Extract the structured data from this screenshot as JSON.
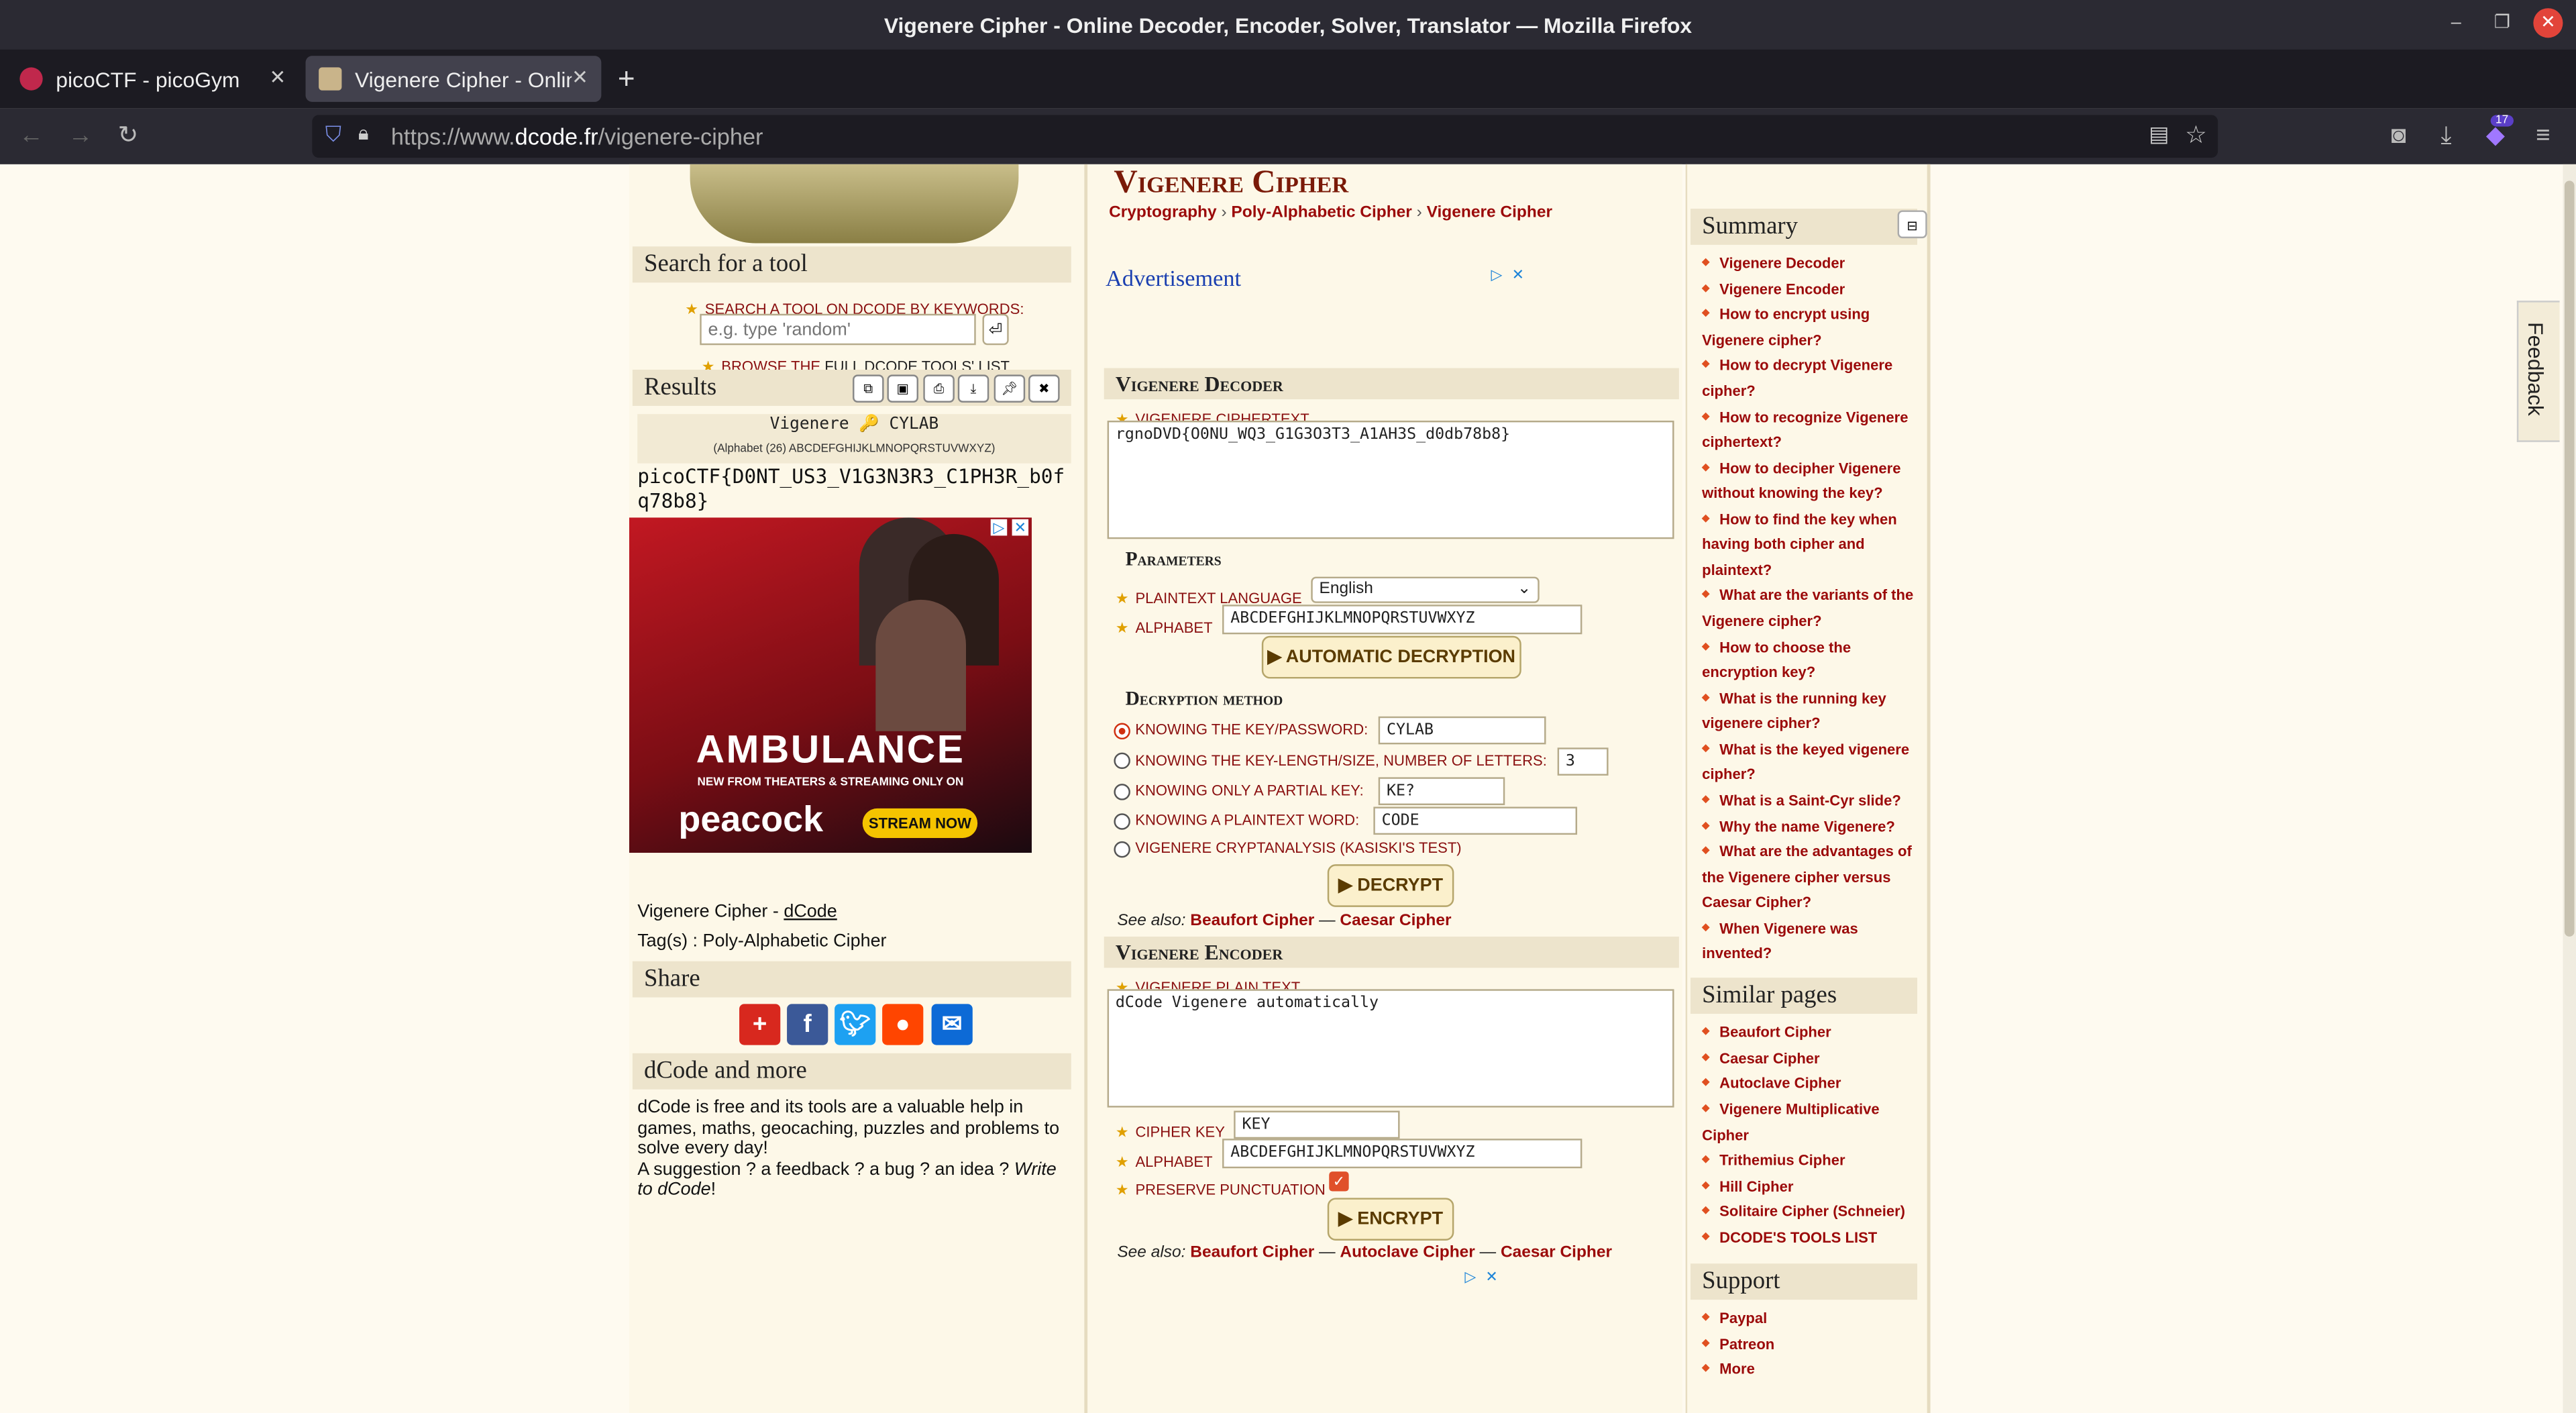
{
  "window": {
    "title": "Vigenere Cipher - Online Decoder, Encoder, Solver, Translator — Mozilla Firefox"
  },
  "tabs": [
    {
      "label": "picoCTF - picoGym"
    },
    {
      "label": "Vigenere Cipher - Online"
    }
  ],
  "urlbar": {
    "prefix": "https://www.",
    "domain": "dcode.fr",
    "path": "/vigenere-cipher"
  },
  "extensions": {
    "badge": "17"
  },
  "left": {
    "search_title": "Search for a tool",
    "search_label": "SEARCH A TOOL ON DCODE BY KEYWORDS:",
    "search_placeholder": "e.g. type 'random'",
    "enter_glyph": "⏎",
    "browse_prefix": "BROWSE THE ",
    "browse_link": "FULL DCODE TOOLS' LIST",
    "results_title": "Results",
    "result_header": "Vigenere 🔑 CYLAB",
    "result_alphabet": "(Alphabet (26) ABCDEFGHIJKLMNOPQRSTUVWXYZ)",
    "result_text": "picoCTF{D0NT_US3_V1G3N3R3_C1PH3R_b0fq78b8}",
    "ad": {
      "title": "AMBULANCE",
      "sub": "NEW FROM THEATERS & STREAMING ONLY ON",
      "brand": "peacock",
      "cta": "STREAM NOW"
    },
    "credit_prefix": "Vigenere Cipher - ",
    "credit_link": "dCode",
    "tags": "Tag(s) : Poly-Alphabetic Cipher",
    "share_title": "Share",
    "more_title": "dCode and more",
    "more_text": "dCode is free and its tools are a valuable help in games, maths, geocaching, puzzles and problems to solve every day!",
    "more_text2": "A suggestion ? a feedback ? a bug ? an idea ? ",
    "more_link": "Write to dCode",
    "more_end": "!"
  },
  "main": {
    "title": "Vigenere Cipher",
    "breadcrumb": [
      "Cryptography",
      "Poly-Alphabetic Cipher",
      "Vigenere Cipher"
    ],
    "advert": "Advertisement",
    "decoder": {
      "title": "Vigenere Decoder",
      "cipher_label": "VIGENERE CIPHERTEXT",
      "cipher_value": "rgnoDVD{O0NU_WQ3_G1G3O3T3_A1AH3S_d0db78b8}",
      "params_title": "Parameters",
      "lang_label": "PLAINTEXT LANGUAGE",
      "lang_value": "English",
      "alpha_label": "ALPHABET",
      "alpha_value": "ABCDEFGHIJKLMNOPQRSTUVWXYZ",
      "auto_button": "▶ AUTOMATIC DECRYPTION",
      "method_title": "Decryption method",
      "m1": "KNOWING THE KEY/PASSWORD:",
      "m1_value": "CYLAB",
      "m2": "KNOWING THE KEY-LENGTH/SIZE, NUMBER OF LETTERS:",
      "m2_value": "3",
      "m3": "KNOWING ONLY A PARTIAL KEY:",
      "m3_value": "KE?",
      "m4": "KNOWING A PLAINTEXT WORD:",
      "m4_value": "CODE",
      "m5": "VIGENERE CRYPTANALYSIS (KASISKI'S TEST)",
      "decrypt_button": "▶ DECRYPT",
      "see_also": "See also:",
      "see_links": [
        "Beaufort Cipher",
        "Caesar Cipher"
      ]
    },
    "encoder": {
      "title": "Vigenere Encoder",
      "plain_label": "VIGENERE PLAIN TEXT",
      "plain_value": "dCode Vigenere automatically",
      "key_label": "CIPHER KEY",
      "key_value": "KEY",
      "alpha_label": "ALPHABET",
      "alpha_value": "ABCDEFGHIJKLMNOPQRSTUVWXYZ",
      "punct_label": "PRESERVE PUNCTUATION",
      "encrypt_button": "▶ ENCRYPT",
      "see_also": "See also:",
      "see_links": [
        "Beaufort Cipher",
        "Autoclave Cipher",
        "Caesar Cipher"
      ]
    },
    "separator": "—"
  },
  "right": {
    "summary_title": "Summary",
    "summary": [
      "Vigenere Decoder",
      "Vigenere Encoder",
      "How to encrypt using Vigenere cipher?",
      "How to decrypt Vigenere cipher?",
      "How to recognize Vigenere ciphertext?",
      "How to decipher Vigenere without knowing the key?",
      "How to find the key when having both cipher and plaintext?",
      "What are the variants of the Vigenere cipher?",
      "How to choose the encryption key?",
      "What is the running key vigenere cipher?",
      "What is the keyed vigenere cipher?",
      "What is a Saint-Cyr slide?",
      "Why the name Vigenere?",
      "What are the advantages of the Vigenere cipher versus Caesar Cipher?",
      "When Vigenere was invented?"
    ],
    "similar_title": "Similar pages",
    "similar": [
      "Beaufort Cipher",
      "Caesar Cipher",
      "Autoclave Cipher",
      "Vigenere Multiplicative Cipher",
      "Trithemius Cipher",
      "Hill Cipher",
      "Solitaire Cipher (Schneier)",
      "DCODE'S TOOLS LIST"
    ],
    "support_title": "Support",
    "support": [
      "Paypal",
      "Patreon",
      "More"
    ]
  },
  "feedback": "Feedback",
  "colors": {
    "accent": "#9b0a0a",
    "chrome": "#2b2a33",
    "page_bg": "#fdf8e8"
  }
}
